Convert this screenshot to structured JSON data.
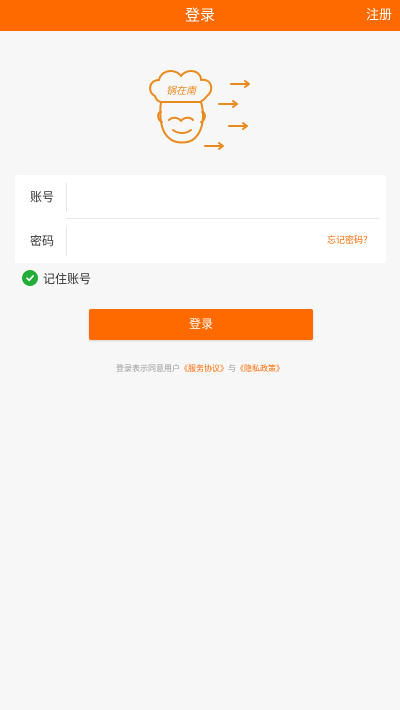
{
  "header": {
    "title": "登录",
    "register_label": "注册"
  },
  "logo": {
    "text": "锅在南"
  },
  "form": {
    "account_label": "账号",
    "account_value": "",
    "password_label": "密码",
    "password_value": "",
    "forgot_label": "忘记密码？"
  },
  "remember": {
    "label": "记住账号",
    "checked": true
  },
  "login_button": "登录",
  "agreement": {
    "prefix": "登录表示同意用户",
    "service_link": "《服务协议》",
    "connector": "与",
    "privacy_link": "《隐私政策》"
  },
  "colors": {
    "brand": "#ff6a00",
    "check": "#22ac38",
    "background": "#f7f7f7"
  }
}
